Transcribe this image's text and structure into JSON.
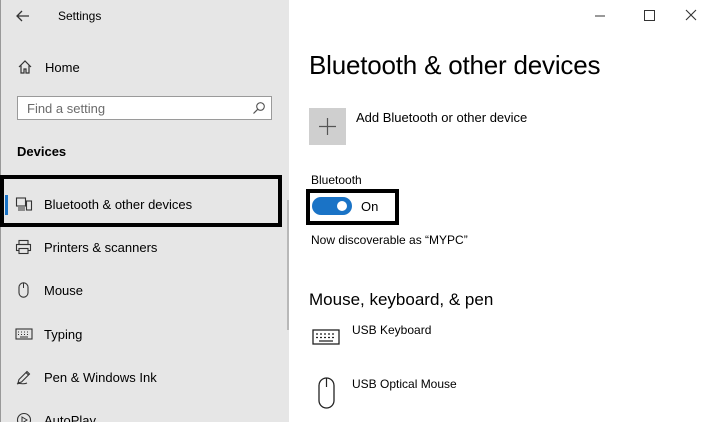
{
  "app": {
    "title": "Settings"
  },
  "sidebar": {
    "home_label": "Home",
    "search_placeholder": "Find a setting",
    "section_title": "Devices",
    "items": [
      {
        "label": "Bluetooth & other devices",
        "icon": "bluetooth-devices-icon",
        "active": true
      },
      {
        "label": "Printers & scanners",
        "icon": "printer-icon",
        "active": false
      },
      {
        "label": "Mouse",
        "icon": "mouse-icon",
        "active": false
      },
      {
        "label": "Typing",
        "icon": "keyboard-icon",
        "active": false
      },
      {
        "label": "Pen & Windows Ink",
        "icon": "pen-icon",
        "active": false
      },
      {
        "label": "AutoPlay",
        "icon": "autoplay-icon",
        "active": false
      }
    ]
  },
  "main": {
    "page_title": "Bluetooth & other devices",
    "add_device_label": "Add Bluetooth or other device",
    "bluetooth_label": "Bluetooth",
    "bluetooth_state": "On",
    "discoverable_text": "Now discoverable as “MYPC”",
    "section_mouse_keyboard": "Mouse, keyboard, & pen",
    "devices": [
      {
        "name": "USB Keyboard",
        "icon": "keyboard-icon"
      },
      {
        "name": "USB Optical Mouse",
        "icon": "mouse-icon"
      }
    ]
  },
  "colors": {
    "accent": "#1a73c6",
    "sidebar_bg": "#e6e6e6",
    "highlight_border": "#000000"
  }
}
